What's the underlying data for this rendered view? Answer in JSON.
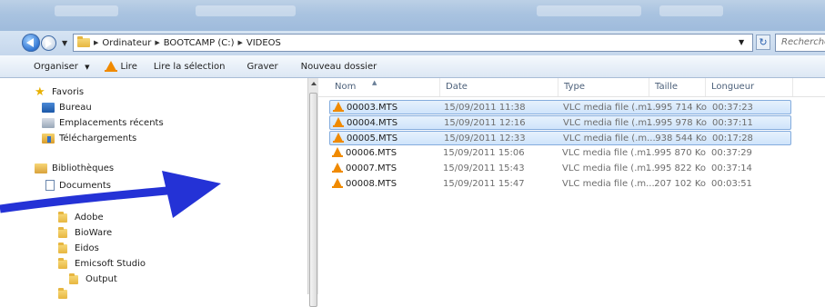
{
  "address": {
    "crumbs": [
      "Ordinateur",
      "BOOTCAMP (C:)",
      "VIDEOS"
    ],
    "search_placeholder": "Recherche"
  },
  "toolbar": {
    "organize": "Organiser",
    "play": "Lire",
    "play_selection": "Lire la sélection",
    "burn": "Graver",
    "new_folder": "Nouveau dossier"
  },
  "nav": {
    "favorites": "Favoris",
    "desktop": "Bureau",
    "recent": "Emplacements récents",
    "downloads": "Téléchargements",
    "libraries": "Bibliothèques",
    "documents": "Documents",
    "folders": [
      "Adobe",
      "BioWare",
      "Eidos",
      "Emicsoft Studio",
      "Output"
    ]
  },
  "columns": {
    "name": "Nom",
    "date": "Date",
    "type": "Type",
    "size": "Taille",
    "length": "Longueur"
  },
  "files": [
    {
      "name": "00003.MTS",
      "date": "15/09/2011 11:38",
      "type": "VLC media file (.m...",
      "size": "1 995 714 Ko",
      "length": "00:37:23",
      "selected": true
    },
    {
      "name": "00004.MTS",
      "date": "15/09/2011 12:16",
      "type": "VLC media file (.m...",
      "size": "1 995 978 Ko",
      "length": "00:37:11",
      "selected": true
    },
    {
      "name": "00005.MTS",
      "date": "15/09/2011 12:33",
      "type": "VLC media file (.m...",
      "size": "938 544 Ko",
      "length": "00:17:28",
      "selected": true
    },
    {
      "name": "00006.MTS",
      "date": "15/09/2011 15:06",
      "type": "VLC media file (.m...",
      "size": "1 995 870 Ko",
      "length": "00:37:29",
      "selected": false
    },
    {
      "name": "00007.MTS",
      "date": "15/09/2011 15:43",
      "type": "VLC media file (.m...",
      "size": "1 995 822 Ko",
      "length": "00:37:14",
      "selected": false
    },
    {
      "name": "00008.MTS",
      "date": "15/09/2011 15:47",
      "type": "VLC media file (.m...",
      "size": "207 102 Ko",
      "length": "00:03:51",
      "selected": false
    }
  ],
  "colors": {
    "selection_border": "#84acdd",
    "selection_fill": "#cfe4fb",
    "annotation_arrow": "#2432d6",
    "vlc_orange": "#f08a00"
  }
}
